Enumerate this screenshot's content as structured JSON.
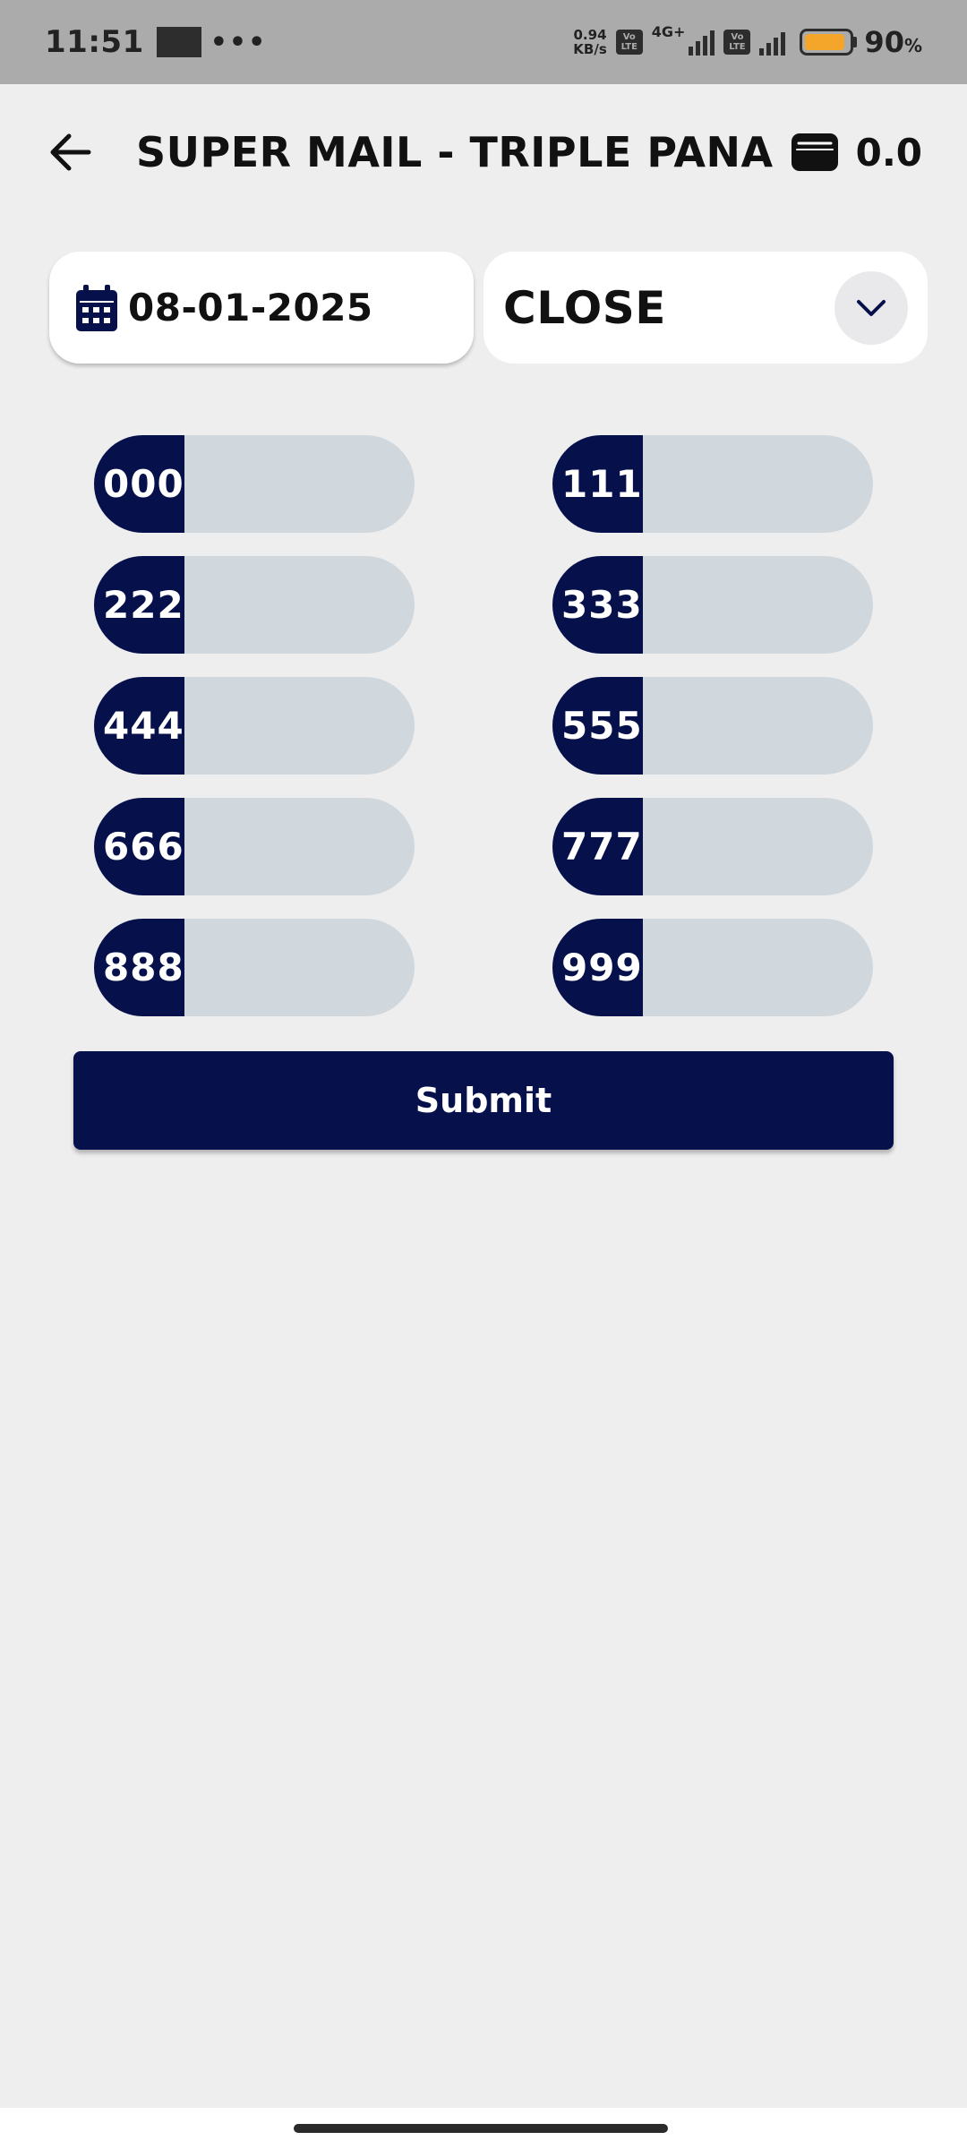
{
  "status_bar": {
    "time": "11:51",
    "net_speed_value": "0.94",
    "net_speed_unit": "KB/s",
    "volte_1_top": "Vo",
    "volte_1_bottom": "LTE",
    "network_type": "4G+",
    "volte_2_top": "Vo",
    "volte_2_bottom": "LTE",
    "battery_percent": "90",
    "battery_symbol": "%",
    "battery_level": 0.9,
    "battery_color": "#f4a62a"
  },
  "header": {
    "title": "SUPER MAIL - TRIPLE PANA",
    "wallet_balance": "0.0"
  },
  "filters": {
    "date": "08-01-2025",
    "session": "CLOSE"
  },
  "pana_items": [
    {
      "label": "000",
      "value": ""
    },
    {
      "label": "111",
      "value": ""
    },
    {
      "label": "222",
      "value": ""
    },
    {
      "label": "333",
      "value": ""
    },
    {
      "label": "444",
      "value": ""
    },
    {
      "label": "555",
      "value": ""
    },
    {
      "label": "666",
      "value": ""
    },
    {
      "label": "777",
      "value": ""
    },
    {
      "label": "888",
      "value": ""
    },
    {
      "label": "999",
      "value": ""
    }
  ],
  "submit_label": "Submit",
  "colors": {
    "primary": "#06104a",
    "input_bg": "#d0d8de",
    "page_bg": "#eeeeee",
    "status_bar_bg": "#ababab"
  }
}
